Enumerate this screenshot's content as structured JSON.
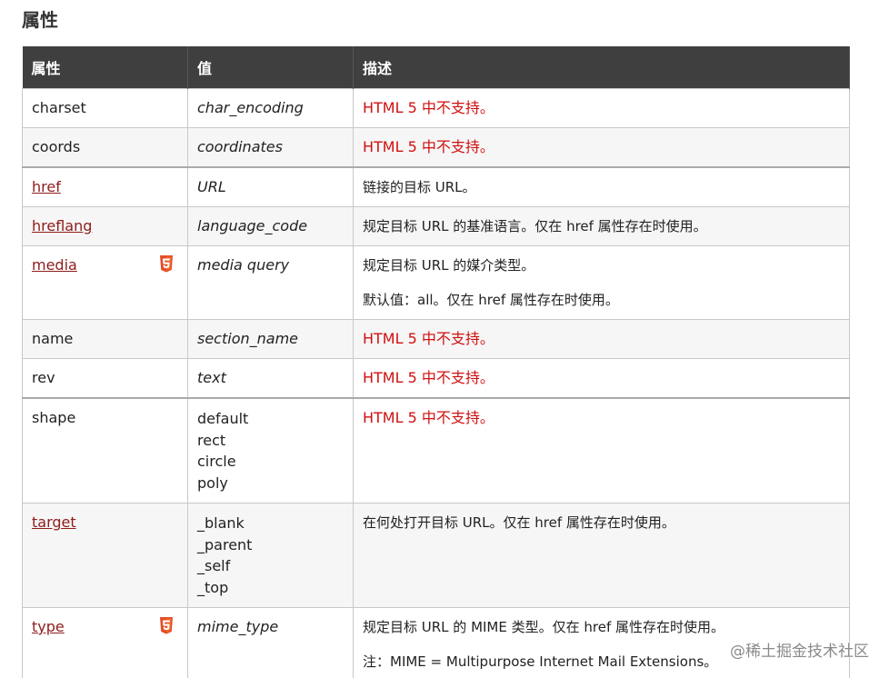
{
  "page": {
    "title": "属性",
    "watermark": "@稀土掘金技术社区"
  },
  "table": {
    "headers": [
      "属性",
      "值",
      "描述"
    ],
    "rows": [
      {
        "attr": "charset",
        "value": "char_encoding",
        "desc": "HTML 5 中不支持。"
      },
      {
        "attr": "coords",
        "value": "coordinates",
        "desc": "HTML 5 中不支持。"
      },
      {
        "attr": "href",
        "value": "URL",
        "desc": "链接的目标 URL。"
      },
      {
        "attr": "hreflang",
        "value": "language_code",
        "desc": "规定目标 URL 的基准语言。仅在 href 属性存在时使用。"
      },
      {
        "attr": "media",
        "value": "media query",
        "desc": "规定目标 URL 的媒介类型。",
        "desc2": "默认值：all。仅在 href 属性存在时使用。"
      },
      {
        "attr": "name",
        "value": "section_name",
        "desc": "HTML 5 中不支持。"
      },
      {
        "attr": "rev",
        "value": "text",
        "desc": "HTML 5 中不支持。"
      },
      {
        "attr": "shape",
        "values": [
          "default",
          "rect",
          "circle",
          "poly"
        ],
        "desc": "HTML 5 中不支持。"
      },
      {
        "attr": "target",
        "values": [
          "_blank",
          "_parent",
          "_self",
          "_top"
        ],
        "desc": "在何处打开目标 URL。仅在 href 属性存在时使用。"
      },
      {
        "attr": "type",
        "value": "mime_type",
        "desc": "规定目标 URL 的 MIME 类型。仅在 href 属性存在时使用。",
        "desc2": "注：MIME = Multipurpose Internet Mail Extensions。"
      }
    ]
  },
  "icons": {
    "html5_color": "#e44d26",
    "html5_dark": "#f16529"
  }
}
